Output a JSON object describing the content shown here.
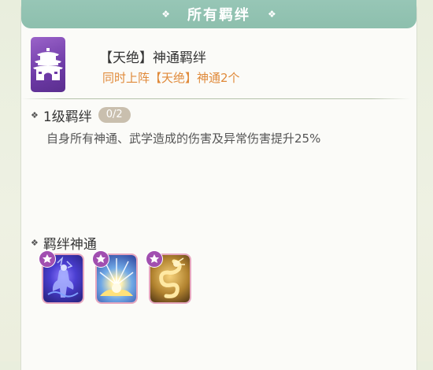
{
  "header": {
    "title": "所有羁绊",
    "ornament_left": "❖",
    "ornament_right": "❖"
  },
  "bond": {
    "name": "【天绝】神通羁绊",
    "condition": "同时上阵【天绝】神通2个",
    "icon": "palace-gate-icon",
    "icon_bg_color": "#7a44b0"
  },
  "level": {
    "bullet": "❖",
    "title": "1级羁绊",
    "progress_text": "0/2",
    "progress": {
      "current": 0,
      "required": 2
    },
    "description": "自身所有神通、武学造成的伤害及异常伤害提升25%"
  },
  "skills_section": {
    "bullet": "❖",
    "title": "羁绊神通",
    "items": [
      {
        "icon": "phantom-warrior-skill-icon",
        "bg_color": "#3b38b5",
        "badge_icon": "faction-emblem-icon"
      },
      {
        "icon": "light-burst-skill-icon",
        "bg_color": "#3a7cc9",
        "badge_icon": "faction-emblem-icon"
      },
      {
        "icon": "golden-dragon-skill-icon",
        "bg_color": "#b08a3a",
        "badge_icon": "faction-emblem-icon"
      }
    ]
  },
  "colors": {
    "header": "#93c3b2",
    "condition_text": "#e08a3a",
    "badge": "#c9bfae",
    "skill_frame": "#e7a7bf"
  }
}
